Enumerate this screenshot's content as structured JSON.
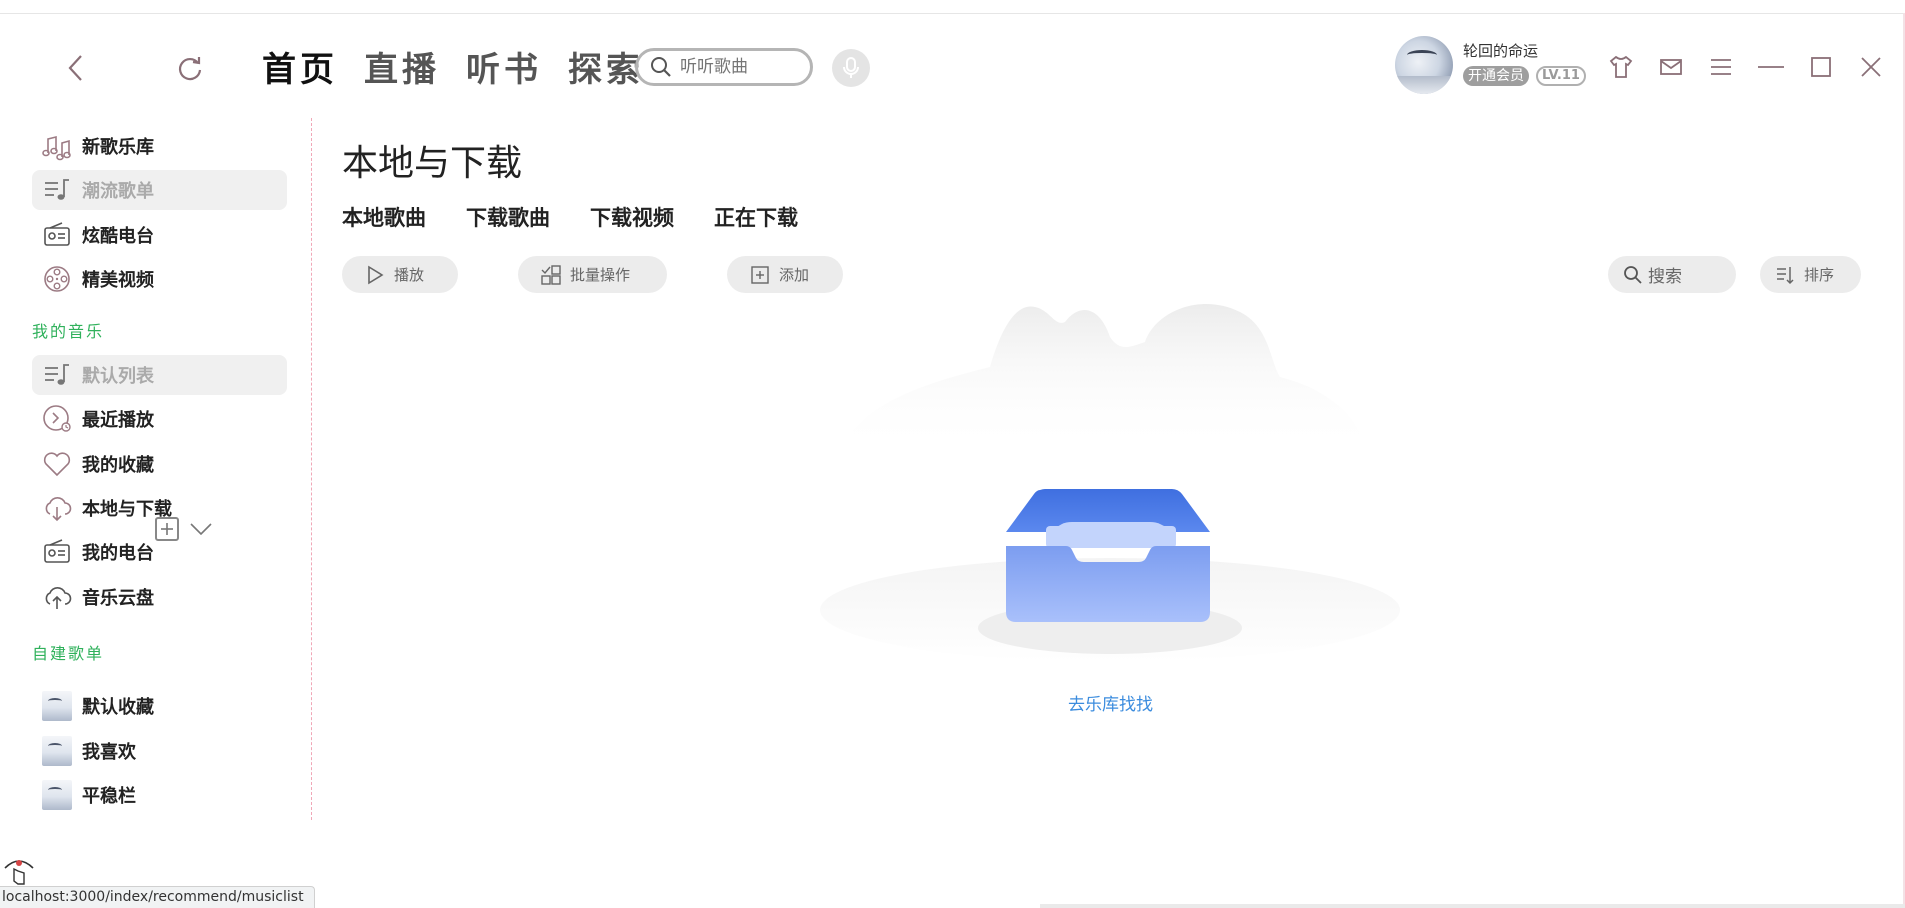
{
  "header": {
    "tabs": [
      {
        "label": "首页",
        "active": true
      },
      {
        "label": "直播",
        "active": false
      },
      {
        "label": "听书",
        "active": false
      },
      {
        "label": "探索",
        "active": false
      }
    ],
    "search_placeholder": "听听歌曲"
  },
  "user": {
    "name": "轮回的命运",
    "vip_label": "开通会员",
    "level": "LV.11"
  },
  "sidebar": {
    "discover_items": [
      {
        "label": "新歌乐库",
        "icon": "music-notes-icon",
        "selected": false
      },
      {
        "label": "潮流歌单",
        "icon": "playlist-icon",
        "selected": true
      },
      {
        "label": "炫酷电台",
        "icon": "radio-icon",
        "selected": false
      },
      {
        "label": "精美视频",
        "icon": "film-reel-icon",
        "selected": false
      }
    ],
    "my_music_title": "我的音乐",
    "my_music_items": [
      {
        "label": "默认列表",
        "icon": "playlist-icon",
        "selected": true
      },
      {
        "label": "最近播放",
        "icon": "recent-play-icon",
        "selected": false
      },
      {
        "label": "我的收藏",
        "icon": "heart-icon",
        "selected": false
      },
      {
        "label": "本地与下载",
        "icon": "cloud-download-icon",
        "selected": false
      },
      {
        "label": "我的电台",
        "icon": "radio-icon",
        "selected": false
      },
      {
        "label": "音乐云盘",
        "icon": "cloud-upload-icon",
        "selected": false
      }
    ],
    "custom_playlists_title": "自建歌单",
    "custom_playlists": [
      {
        "label": "默认收藏"
      },
      {
        "label": "我喜欢"
      },
      {
        "label": "平稳栏"
      }
    ]
  },
  "main": {
    "title": "本地与下载",
    "sub_tabs": [
      "本地歌曲",
      "下载歌曲",
      "下载视频",
      "正在下载"
    ],
    "toolbar": {
      "play_label": "播放",
      "batch_label": "批量操作",
      "add_label": "添加",
      "search_label": "搜索",
      "sort_label": "排序"
    },
    "empty_link": "去乐库找找"
  },
  "status_url": "localhost:3000/index/recommend/musiclist",
  "colors": {
    "accent_green": "#2fb15b",
    "link_blue": "#3b8cde",
    "icon_pinkish": "#9c7b84"
  }
}
